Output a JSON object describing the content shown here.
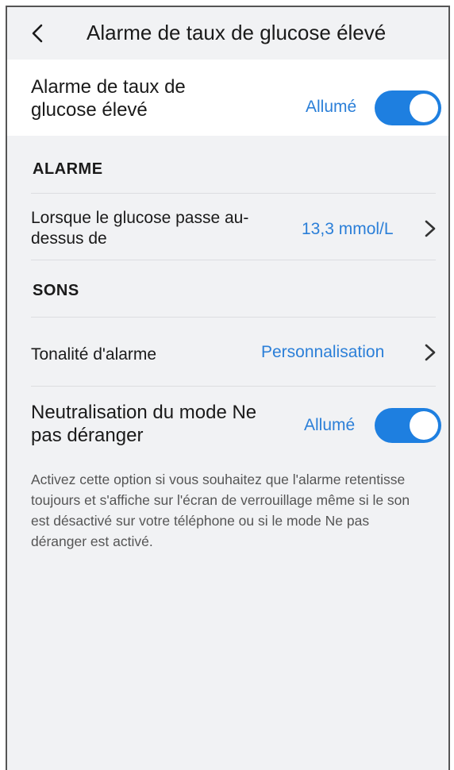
{
  "header": {
    "title": "Alarme de taux de glucose élevé"
  },
  "main_toggle": {
    "label": "Alarme de taux de glucose élevé",
    "state": "Allumé"
  },
  "alarm_section": {
    "heading": "ALARME",
    "threshold_row": {
      "label": "Lorsque le glucose passe au-dessus de",
      "value": "13,3 mmol/L"
    }
  },
  "sounds_section": {
    "heading": "SONS",
    "tone_row": {
      "label": "Tonalité d'alarme",
      "value": "Personnalisation"
    },
    "dnd_row": {
      "label": "Neutralisation du mode Ne pas déranger",
      "state": "Allumé"
    },
    "description": "Activez cette option si vous souhaitez que l'alarme retentisse toujours et s'affiche sur l'écran de verrouillage même si le son est désactivé sur votre téléphone ou si le mode Ne pas déranger est activé."
  },
  "colors": {
    "accent": "#1e7fe0",
    "background": "#f1f2f4"
  }
}
